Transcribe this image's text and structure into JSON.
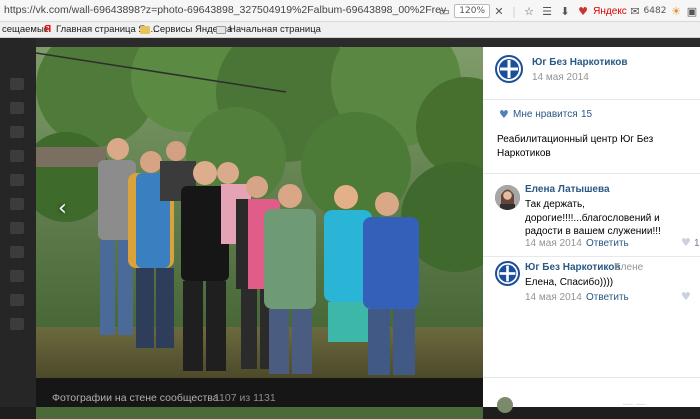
{
  "browser": {
    "url": "https://vk.com/wall-69643898?z=photo-69643898_327504919%2Falbum-69643898_00%2Frev",
    "zoom": "120%",
    "yandex_label": "Яндекс",
    "counter": "6482"
  },
  "bookmarks": {
    "item0": "сещаемые",
    "item1": "Главная страница Ян...",
    "item2": "Сервисы Яндекса",
    "item3": "Начальная страница"
  },
  "viewer": {
    "prev_arrow": "‹",
    "caption_title": "Фотографии на стене сообщества",
    "caption_count": "1107 из 1131"
  },
  "post": {
    "author": "Юг Без Наркотиков",
    "date": "14 мая 2014",
    "like_label": "Мне нравится",
    "like_count": "15",
    "text": "Реабилитационный центр Юг Без Наркотиков"
  },
  "comments": [
    {
      "author": "Елена Латышева",
      "text": "Так держать, дорогие!!!!...благословений и радости в вашем служении!!!",
      "date": "14 мая 2014",
      "reply": "Ответить",
      "likes": "1"
    },
    {
      "author": "Юг Без Наркотиков",
      "addressee": "Елене",
      "text": "Елена, Спасибо))))",
      "date": "14 мая 2014",
      "reply": "Ответить"
    }
  ],
  "colors": {
    "link": "#2a5885",
    "logo_blue": "#1b4e9b",
    "like_blue": "#5181b8"
  }
}
